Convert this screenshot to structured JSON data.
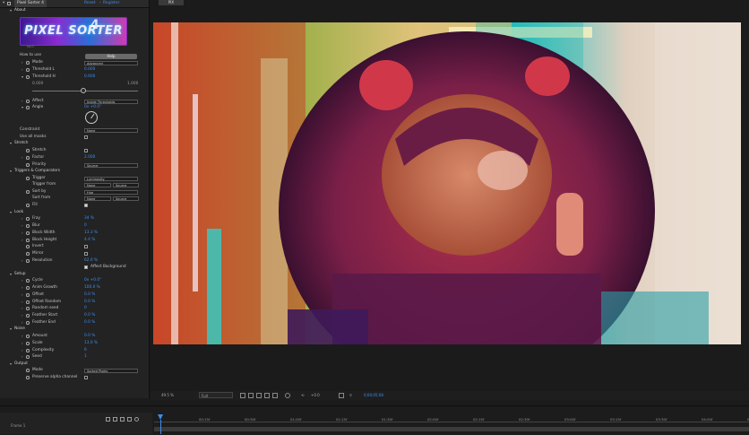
{
  "panel": {
    "tab_title": "Pixel Sorter 4",
    "tab_reset": "Reset",
    "tab_register": "Register",
    "effect_name": "Pixel Sorter 4",
    "about_label": "About",
    "logo_text": "PIXEL SORTER",
    "logo_badge": "4",
    "logo_version": "v4.0",
    "howto_label": "How to use",
    "help_button": "Help",
    "mode_label": "Mode",
    "mode_value": "Advanced",
    "threshold_l_label": "Threshold L",
    "threshold_l_value": "0.000",
    "threshold_h_label": "Threshold H",
    "threshold_h_value": "0.600",
    "slider_min": "0.000",
    "slider_max": "1.000",
    "affect_label": "Affect",
    "affect_value": "Inside Thresholds",
    "angle_label": "Angle",
    "angle_value": "0x +0.0°",
    "constraint_label": "Constraint",
    "constraint_value": "None",
    "use_all_masks_label": "Use all masks",
    "stretch_section": "Stretch",
    "stretch_label": "Stretch",
    "factor_label": "Factor",
    "factor_value": "2.000",
    "priority_label": "Priority",
    "priority_value": "Source",
    "triggers_section": "Triggers & Comparators",
    "trigger_label": "Trigger",
    "trigger_value": "Luminosity",
    "trigger_from_label": "Trigger from",
    "trigger_from_a": "None",
    "trigger_from_b": "Source",
    "sort_by_label": "Sort by",
    "sort_by_value": "Hue",
    "sort_from_label": "Sort from",
    "sort_from_a": "None",
    "sort_from_b": "Source",
    "fill_label": "Fill",
    "look_section": "Look",
    "fray_label": "Fray",
    "fray_value": "34 %",
    "blur_label": "Blur",
    "blur_value": "0",
    "block_width_label": "Block Width",
    "block_width_value": "13.3 %",
    "block_height_label": "Block Height",
    "block_height_value": "4.4 %",
    "invert_label": "Invert",
    "mirror_label": "Mirror",
    "resolution_label": "Resolution",
    "resolution_value": "62.0 %",
    "affect_background_label": "Affect Background",
    "setup_section": "Setup",
    "cycle_label": "Cycle",
    "cycle_value": "0x +0.0°",
    "anim_growth_label": "Anim Growth",
    "anim_growth_value": "100.0 %",
    "offset_label": "Offset",
    "offset_value": "0.0 %",
    "offset_random_label": "Offset Random",
    "offset_random_value": "0.0 %",
    "random_seed_label": "Random seed",
    "random_seed_value": "0",
    "feather_start_label": "Feather Start",
    "feather_start_value": "0.0 %",
    "feather_end_label": "Feather End",
    "feather_end_value": "0.0 %",
    "noise_section": "Noise",
    "amount_label": "Amount",
    "amount_value": "0.0 %",
    "scale_label": "Scale",
    "scale_value": "13.0 %",
    "complexity_label": "Complexity",
    "complexity_value": "6",
    "seed_label": "Seed",
    "seed_value": "1",
    "output_section": "Output",
    "output_mode_label": "Mode",
    "output_mode_value": "Sorted Pixels",
    "preserve_alpha_label": "Preserve alpha channel"
  },
  "viewer": {
    "tab_label": "PIX",
    "zoom": "49.5 %",
    "quality": "Full",
    "exposure": "+0.0",
    "timecode": "0;00;05;08"
  },
  "timeline": {
    "ticks": [
      "00:15f",
      "00:30f",
      "01:00f",
      "01:15f",
      "01:30f",
      "02:00f",
      "02:15f",
      "02:30f",
      "03:00f",
      "03:15f",
      "03:30f",
      "04:00f",
      "04:15f"
    ],
    "current": "Frame 1"
  }
}
